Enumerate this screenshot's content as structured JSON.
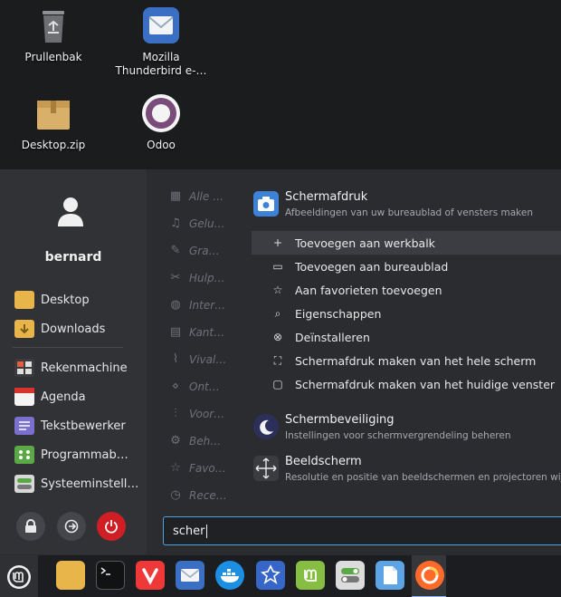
{
  "desktop": {
    "icons": [
      {
        "label": "Prullenbak",
        "icon": "trash-icon"
      },
      {
        "label": "Mozilla Thunderbird e-…",
        "icon": "thunderbird-icon"
      },
      {
        "label": "Desktop.zip",
        "icon": "archive-icon"
      },
      {
        "label": "Odoo",
        "icon": "odoo-icon"
      }
    ]
  },
  "menu": {
    "username": "bernard",
    "places": [
      {
        "label": "Desktop",
        "icon": "folder-icon"
      },
      {
        "label": "Downloads",
        "icon": "folder-download-icon"
      }
    ],
    "favorites": [
      {
        "label": "Rekenmachine",
        "icon": "calculator-icon"
      },
      {
        "label": "Agenda",
        "icon": "calendar-icon"
      },
      {
        "label": "Tekstbewerker",
        "icon": "text-editor-icon"
      },
      {
        "label": "Programmab…",
        "icon": "software-manager-icon"
      },
      {
        "label": "Systeeminstell…",
        "icon": "settings-icon"
      }
    ],
    "categories": [
      {
        "label": "Alle …",
        "icon": "grid-icon"
      },
      {
        "label": "Gelu…",
        "icon": "sound-icon"
      },
      {
        "label": "Gra…",
        "icon": "graphics-icon"
      },
      {
        "label": "Hulp…",
        "icon": "tools-icon"
      },
      {
        "label": "Inter…",
        "icon": "globe-icon"
      },
      {
        "label": "Kant…",
        "icon": "office-icon"
      },
      {
        "label": "Vival…",
        "icon": "paperclip-icon"
      },
      {
        "label": "Ont…",
        "icon": "code-icon"
      },
      {
        "label": "Voor…",
        "icon": "sliders-icon"
      },
      {
        "label": "Beh…",
        "icon": "gear-icon"
      },
      {
        "label": "Favo…",
        "icon": "star-icon"
      },
      {
        "label": "Rece…",
        "icon": "recent-icon"
      }
    ],
    "results": {
      "screenshot": {
        "title": "Schermafdruk",
        "subtitle": "Afbeeldingen van uw bureaublad of vensters maken"
      },
      "context_actions": [
        {
          "label": "Toevoegen aan werkbalk",
          "icon": "plus-icon",
          "glyph": "+"
        },
        {
          "label": "Toevoegen aan bureaublad",
          "icon": "monitor-icon",
          "glyph": "▭"
        },
        {
          "label": "Aan favorieten toevoegen",
          "icon": "star-outline-icon",
          "glyph": "☆"
        },
        {
          "label": "Eigenschappen",
          "icon": "properties-icon",
          "glyph": "⌕"
        },
        {
          "label": "Deïnstalleren",
          "icon": "uninstall-icon",
          "glyph": "⊗"
        },
        {
          "label": "Schermafdruk maken van het hele scherm",
          "icon": "fullscreen-icon",
          "glyph": "⛶"
        },
        {
          "label": "Schermafdruk maken van het huidige venster",
          "icon": "window-icon",
          "glyph": "▢"
        }
      ],
      "screensaver": {
        "title": "Schermbeveiliging",
        "subtitle": "Instellingen voor schermvergrendeling beheren"
      },
      "display": {
        "title": "Beeldscherm",
        "subtitle": "Resolutie en positie van beeldschermen en projectoren wijzigen"
      }
    },
    "search": {
      "value": "scher"
    }
  },
  "taskbar": {
    "apps": [
      "files-icon",
      "terminal-icon",
      "vivaldi-icon",
      "mail-icon",
      "docker-icon",
      "linux-app-icon",
      "mint-update-icon",
      "toggle-settings-icon",
      "document-viewer-icon",
      "firefox-icon"
    ]
  },
  "colors": {
    "accent": "#4aa3df",
    "power": "#d01e25",
    "mint": "#86be43"
  }
}
